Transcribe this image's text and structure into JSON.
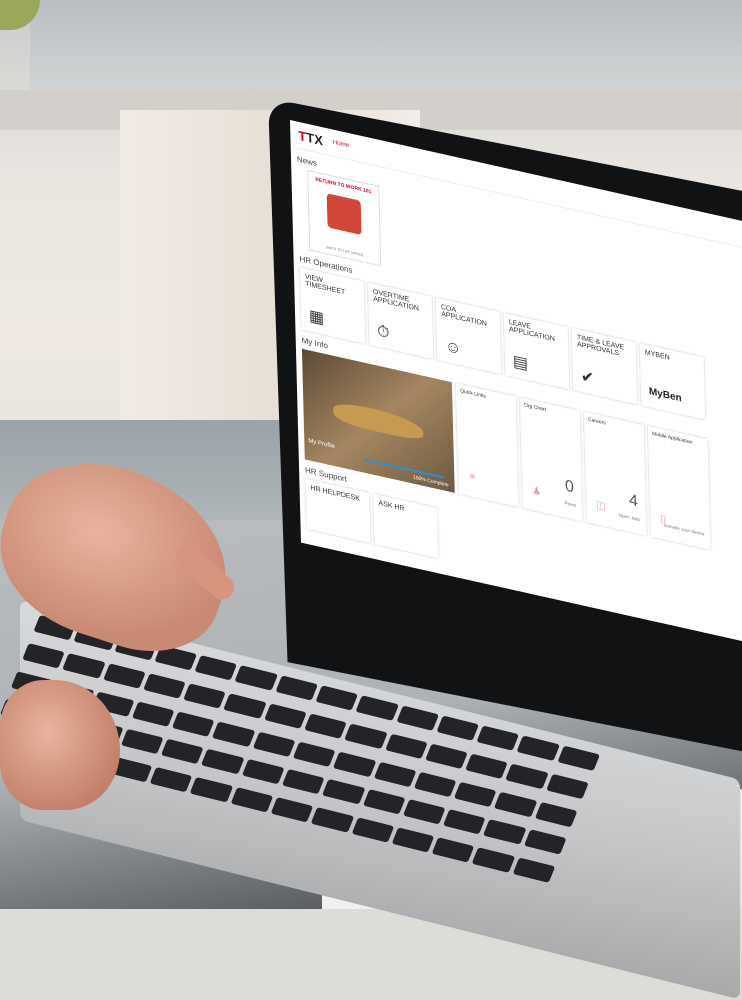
{
  "app": {
    "logo_text": "TX",
    "nav_home": "Home"
  },
  "news": {
    "heading": "News",
    "card_title": "RETURN TO WORK 101",
    "card_subtitle": "BACK TO THE OFFICE"
  },
  "hr_operations": {
    "heading": "HR Operations",
    "tiles": [
      {
        "label": "VIEW TIMESHEET",
        "icon": "calendar-icon"
      },
      {
        "label": "OVERTIME APPLICATION",
        "icon": "stopwatch-icon"
      },
      {
        "label": "COA APPLICATION",
        "icon": "user-badge-icon"
      },
      {
        "label": "LEAVE APPLICATION",
        "icon": "calendar-grid-icon"
      },
      {
        "label": "TIME & LEAVE APPROVALS",
        "icon": "approval-icon"
      },
      {
        "label": "MYBEN",
        "icon": "myben-logo"
      }
    ],
    "myben_logo": "MyBen"
  },
  "my_info": {
    "heading": "My Info",
    "profile_label": "My Profile",
    "profile_progress_text": "100% Complete",
    "profile_progress": 1.0,
    "quick_links": "Quick Links",
    "org_chart": {
      "title": "Org Chart",
      "value": "0",
      "sub": "Peers"
    },
    "careers": {
      "title": "Careers",
      "value": "4",
      "sub": "Open Jobs"
    },
    "mobile": {
      "title": "Mobile Application",
      "sub": "Activate your device"
    }
  },
  "hr_support": {
    "heading": "HR Support",
    "tiles": [
      {
        "label": "HR HELPDESK"
      },
      {
        "label": "ASK HR"
      }
    ]
  },
  "colors": {
    "brand_red": "#d0021b",
    "progress_blue": "#2f8fd4"
  }
}
